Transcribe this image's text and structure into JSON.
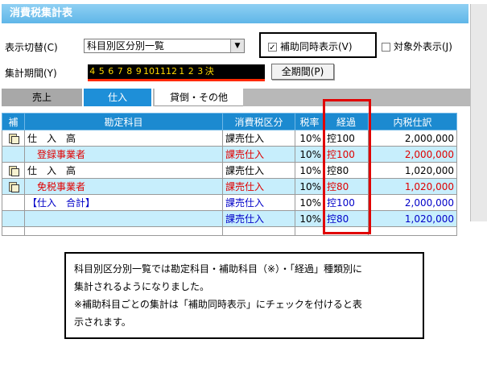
{
  "window": {
    "title": "消費税集計表"
  },
  "controls": {
    "display_switch_label": "表示切替(C)",
    "display_switch_value": "科目別区分別一覧",
    "aux_simultaneous": {
      "label": "補助同時表示(V)",
      "checked": true,
      "check_glyph": "✓"
    },
    "out_of_scope": {
      "label": "対象外表示(J)",
      "checked": false
    },
    "period_label": "集計期間(Y)",
    "period_months": [
      "4",
      "5",
      "6",
      "7",
      "8",
      "9",
      "10",
      "11",
      "12",
      "1",
      "2",
      "3",
      "決"
    ],
    "full_period_button": "全期間(P)"
  },
  "tabs": [
    {
      "label": "売上"
    },
    {
      "label": "仕入"
    },
    {
      "label": "貸倒・その他"
    }
  ],
  "table": {
    "headers": [
      "補",
      "勘定科目",
      "消費税区分",
      "税率",
      "経過",
      "内税仕訳"
    ],
    "rows": [
      {
        "icon": true,
        "account": "仕　入　高",
        "account_color": "black",
        "tax_class": "課売仕入",
        "class_color": "black",
        "rate": "10%",
        "transition": "控100",
        "amount": "2,000,000",
        "color": "black",
        "alt": false
      },
      {
        "icon": false,
        "account": "　登録事業者",
        "account_color": "red",
        "tax_class": "課売仕入",
        "class_color": "red",
        "rate": "10%",
        "transition": "控100",
        "amount": "2,000,000",
        "color": "red",
        "alt": true
      },
      {
        "icon": true,
        "account": "仕　入　高",
        "account_color": "black",
        "tax_class": "課売仕入",
        "class_color": "black",
        "rate": "10%",
        "transition": "控80",
        "amount": "1,020,000",
        "color": "black",
        "alt": false
      },
      {
        "icon": true,
        "account": "　免税事業者",
        "account_color": "red",
        "tax_class": "課売仕入",
        "class_color": "red",
        "rate": "10%",
        "transition": "控80",
        "amount": "1,020,000",
        "color": "red",
        "alt": true
      },
      {
        "icon": false,
        "account": "【仕入　合計】",
        "account_color": "blue",
        "tax_class": "課売仕入",
        "class_color": "blue",
        "rate": "10%",
        "transition": "控100",
        "amount": "2,000,000",
        "color": "blue",
        "alt": false
      },
      {
        "icon": false,
        "account": "",
        "account_color": "blue",
        "tax_class": "課売仕入",
        "class_color": "blue",
        "rate": "10%",
        "transition": "控80",
        "amount": "1,020,000",
        "color": "blue",
        "alt": true
      }
    ]
  },
  "note": {
    "lines": [
      "科目別区分別一覧では勘定科目・補助科目（※）・「経過」種類別に",
      "集計されるようになりました。",
      "※補助科目ごとの集計は「補助同時表示」にチェックを付けると表",
      "示されます。"
    ]
  },
  "colors": {
    "header_blue": "#1c8ad0",
    "alt_row": "#c7eefc",
    "highlight_red": "#e00000"
  }
}
